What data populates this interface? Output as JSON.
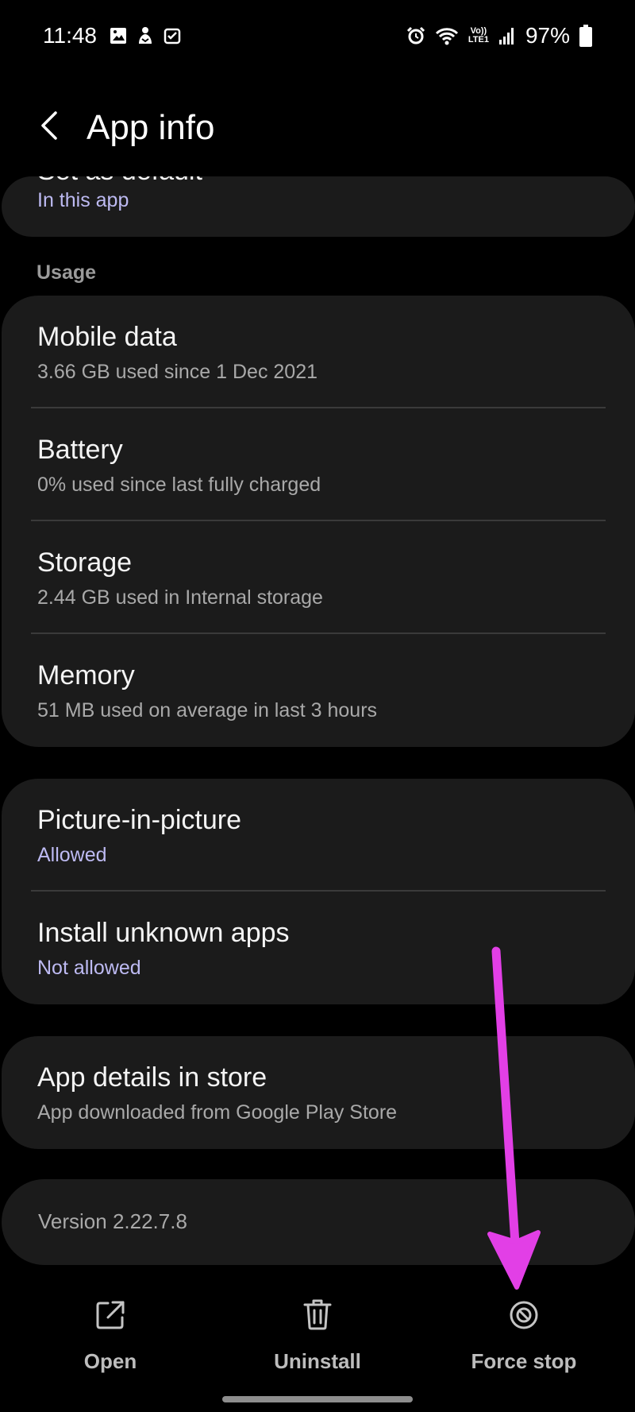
{
  "status_bar": {
    "time": "11:48",
    "network_type_top": "Vo))",
    "network_type_bottom": "LTE1",
    "battery": "97%"
  },
  "header": {
    "title": "App info",
    "back_icon": "chevron-left-icon"
  },
  "set_as_default": {
    "title": "Set as default",
    "subtitle": "In this app"
  },
  "usage": {
    "section_label": "Usage",
    "items": [
      {
        "title": "Mobile data",
        "subtitle": "3.66 GB used since 1 Dec 2021"
      },
      {
        "title": "Battery",
        "subtitle": "0% used since last fully charged"
      },
      {
        "title": "Storage",
        "subtitle": "2.44 GB used in Internal storage"
      },
      {
        "title": "Memory",
        "subtitle": "51 MB used on average in last 3 hours"
      }
    ]
  },
  "permissions": {
    "items": [
      {
        "title": "Picture-in-picture",
        "subtitle": "Allowed"
      },
      {
        "title": "Install unknown apps",
        "subtitle": "Not allowed"
      }
    ]
  },
  "store": {
    "title": "App details in store",
    "subtitle": "App downloaded from Google Play Store"
  },
  "version": {
    "text": "Version 2.22.7.8"
  },
  "actions": {
    "open": {
      "label": "Open",
      "icon": "open-external-icon"
    },
    "uninstall": {
      "label": "Uninstall",
      "icon": "trash-icon"
    },
    "force_stop": {
      "label": "Force stop",
      "icon": "block-icon"
    }
  },
  "colors": {
    "background": "#000000",
    "card": "#1b1b1b",
    "accent_text": "#bdbaf2",
    "annotation_arrow": "#e23fe6"
  }
}
